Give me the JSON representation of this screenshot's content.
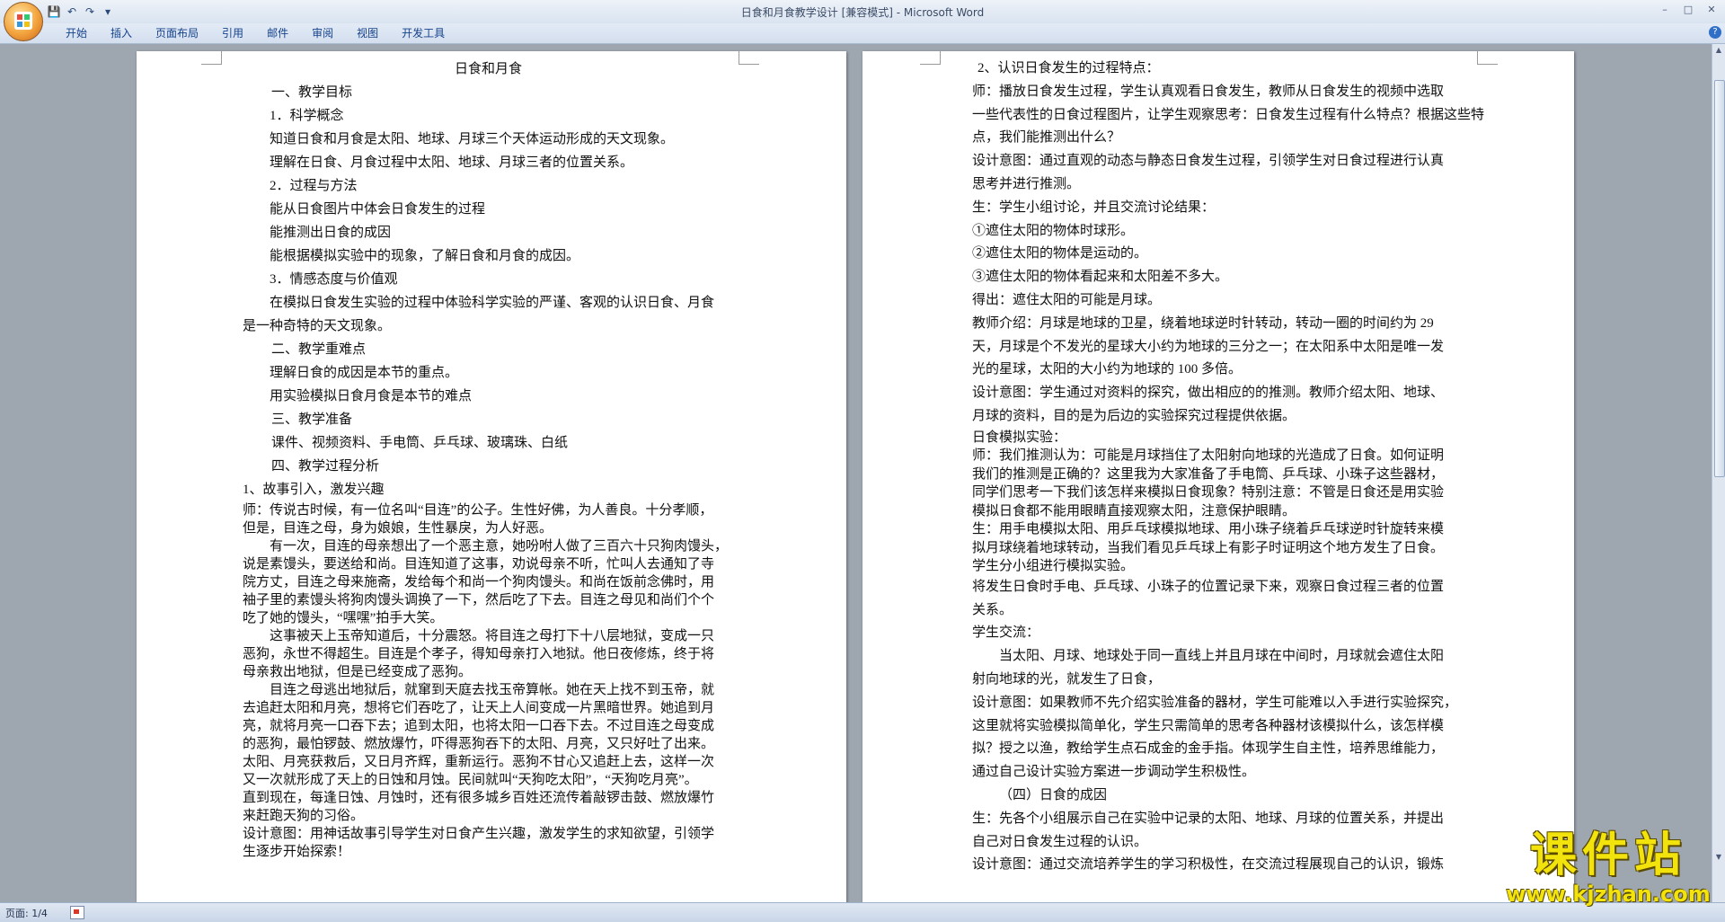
{
  "window": {
    "title": "日食和月食教学设计 [兼容模式] - ",
    "app": "Microsoft Word"
  },
  "qat": {
    "save": "💾",
    "undo": "↶",
    "redo": "↷",
    "more": "▾"
  },
  "window_controls": {
    "min": "–",
    "max": "□",
    "close": "✕"
  },
  "ribbon": {
    "tabs": [
      "开始",
      "插入",
      "页面布局",
      "引用",
      "邮件",
      "审阅",
      "视图",
      "开发工具"
    ],
    "help": "?"
  },
  "page1": {
    "lines": [
      "日食和月食",
      "一、教学目标",
      "1．科学概念",
      "知道日食和月食是太阳、地球、月球三个天体运动形成的天文现象。",
      "理解在日食、月食过程中太阳、地球、月球三者的位置关系。",
      "2．过程与方法",
      "能从日食图片中体会日食发生的过程",
      "能推测出日食的成因",
      "能根据模拟实验中的现象，了解日食和月食的成因。",
      "3．情感态度与价值观",
      "在模拟日食发生实验的过程中体验科学实验的严谨、客观的认识日食、月食",
      "是一种奇特的天文现象。",
      "二、教学重难点",
      "理解日食的成因是本节的重点。",
      "用实验模拟日食月食是本节的难点",
      "三、教学准备",
      "课件、视频资料、手电筒、乒乓球、玻璃珠、白纸",
      "四、教学过程分析",
      "1、故事引入，激发兴趣",
      "师：传说古时候，有一位名叫“目连”的公子。生性好佛，为人善良。十分孝顺，",
      "但是，目连之母，身为娘娘，生性暴戾，为人好恶。",
      "有一次，目连的母亲想出了一个恶主意，她吩咐人做了三百六十只狗肉馒头，",
      "说是素馒头，要送给和尚。目连知道了这事，劝说母亲不听，忙叫人去通知了寺",
      "院方丈，目连之母来施斋，发给每个和尚一个狗肉馒头。和尚在饭前念佛时，用",
      "袖子里的素馒头将狗肉馒头调换了一下，然后吃了下去。目连之母见和尚们个个",
      "吃了她的馒头，“嘿嘿”拍手大笑。",
      "这事被天上玉帝知道后，十分震怒。将目连之母打下十八层地狱，变成一只",
      "恶狗，永世不得超生。目连是个孝子，得知母亲打入地狱。他日夜修炼，终于将",
      "母亲救出地狱，但是已经变成了恶狗。",
      "目连之母逃出地狱后，就窜到天庭去找玉帝算帐。她在天上找不到玉帝，就",
      "去追赶太阳和月亮，想将它们吞吃了，让天上人间变成一片黑暗世界。她追到月",
      "亮，就将月亮一口吞下去；追到太阳，也将太阳一口吞下去。不过目连之母变成",
      "的恶狗，最怕锣鼓、燃放爆竹，吓得恶狗吞下的太阳、月亮，又只好吐了出来。",
      "太阳、月亮获救后，又日月齐辉，重新运行。恶狗不甘心又追赶上去，这样一次",
      "又一次就形成了天上的日蚀和月蚀。民间就叫“天狗吃太阳”，“天狗吃月亮”。",
      "直到现在，每逢日蚀、月蚀时，还有很多城乡百姓还流传着敲锣击鼓、燃放爆竹",
      "来赶跑天狗的习俗。",
      "设计意图：用神话故事引导学生对日食产生兴趣，激发学生的求知欲望，引领学",
      "生逐步开始探索！"
    ]
  },
  "page2": {
    "lines": [
      "2、认识日食发生的过程特点：",
      "师：播放日食发生过程，学生认真观看日食发生，教师从日食发生的视频中选取",
      "一些代表性的日食过程图片，让学生观察思考：日食发生过程有什么特点？根据这些特",
      "点，我们能推测出什么？",
      "设计意图：通过直观的动态与静态日食发生过程，引领学生对日食过程进行认真",
      "思考并进行推测。",
      "生：学生小组讨论，并且交流讨论结果：",
      "①遮住太阳的物体时球形。",
      "②遮住太阳的物体是运动的。",
      "③遮住太阳的物体看起来和太阳差不多大。",
      "得出：遮住太阳的可能是月球。",
      "教师介绍：月球是地球的卫星，绕着地球逆时针转动，转动一圈的时间约为 29",
      "天，月球是个不发光的星球大小约为地球的三分之一；在太阳系中太阳是唯一发",
      "光的星球，太阳的大小约为地球的 100 多倍。",
      "设计意图：学生通过对资料的探究，做出相应的的推测。教师介绍太阳、地球、",
      "月球的资料，目的是为后边的实验探究过程提供依据。",
      "日食模拟实验：",
      "师：我们推测认为：可能是月球挡住了太阳射向地球的光造成了日食。如何证明",
      "我们的推测是正确的？这里我为大家准备了手电筒、乒乓球、小珠子这些器材，",
      "同学们思考一下我们该怎样来模拟日食现象？特别注意：不管是日食还是用实验",
      "模拟日食都不能用眼睛直接观察太阳，注意保护眼睛。",
      "生：用手电模拟太阳、用乒乓球模拟地球、用小珠子绕着乒乓球逆时针旋转来模",
      "拟月球绕着地球转动，当我们看见乒乓球上有影子时证明这个地方发生了日食。",
      "学生分小组进行模拟实验。",
      "将发生日食时手电、乒乓球、小珠子的位置记录下来，观察日食过程三者的位置",
      "关系。",
      "学生交流：",
      "当太阳、月球、地球处于同一直线上并且月球在中间时，月球就会遮住太阳",
      "射向地球的光，就发生了日食，",
      "设计意图：如果教师不先介绍实验准备的器材，学生可能难以入手进行实验探究，",
      "这里就将实验模拟简单化，学生只需简单的思考各种器材该模拟什么，该怎样模",
      "拟？授之以渔，教给学生点石成金的金手指。体现学生自主性，培养思维能力，",
      "通过自己设计实验方案进一步调动学生积极性。",
      "（四）日食的成因",
      "生：先各个小组展示自己在实验中记录的太阳、地球、月球的位置关系，并提出",
      "自己对日食发生过程的认识。",
      "设计意图：通过交流培养学生的学习积极性，在交流过程展现自己的认识，锻炼"
    ]
  },
  "status": {
    "page": "页面: 1/4"
  },
  "watermark": {
    "title": "课件站",
    "url": "www.kjzhan.com"
  }
}
